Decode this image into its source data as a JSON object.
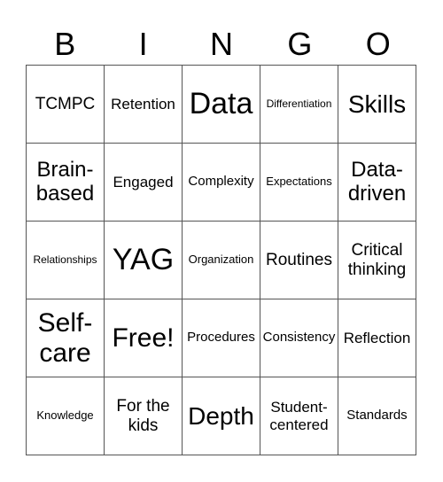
{
  "header": {
    "letters": [
      "B",
      "I",
      "N",
      "G",
      "O"
    ]
  },
  "grid": {
    "cells": [
      [
        "TCMPC",
        "Retention",
        "Data",
        "Differentiation",
        "Skills"
      ],
      [
        "Brain-based",
        "Engaged",
        "Complexity",
        "Expectations",
        "Data-driven"
      ],
      [
        "Relationships",
        "YAG",
        "Organization",
        "Routines",
        "Critical thinking"
      ],
      [
        "Self-care",
        "Free!",
        "Procedures",
        "Consistency",
        "Reflection"
      ],
      [
        "Knowledge",
        "For the kids",
        "Depth",
        "Student-centered",
        "Standards"
      ]
    ]
  },
  "colors": {
    "grid_line": "#555555",
    "text": "#000000",
    "background": "#ffffff"
  }
}
